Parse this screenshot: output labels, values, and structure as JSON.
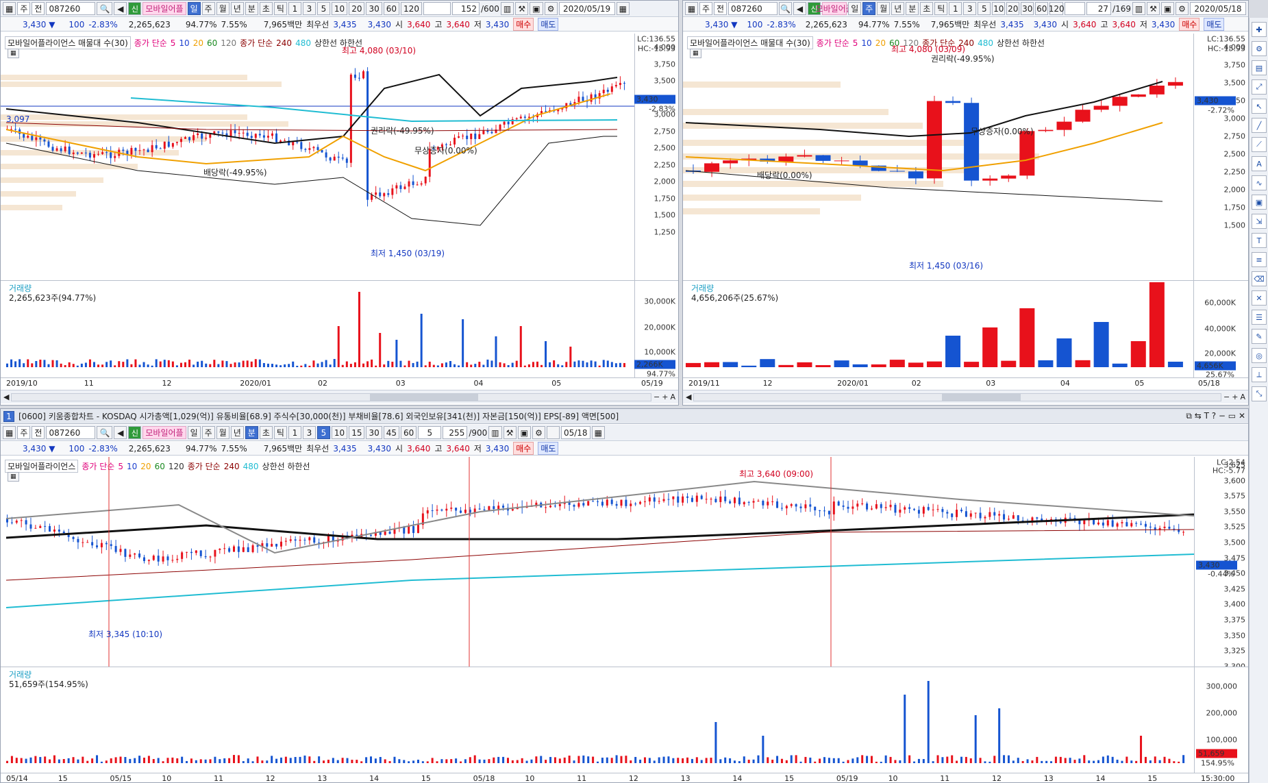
{
  "common": {
    "market": "주",
    "prev": "전",
    "code": "087260",
    "name": "모바일어플",
    "badge": "신",
    "price": "3,430",
    "arrow": "▼",
    "change": "100",
    "change_pct": "-2.83%",
    "volume": "2,265,623",
    "vol_ratio": "94.77%",
    "turnover": "7.55%",
    "amount": "7,965백만",
    "bid_label": "최우선",
    "bid1": "3,435",
    "bid2": "3,430",
    "open_label": "시",
    "open": "3,640",
    "high_label": "고",
    "high": "3,640",
    "low_label": "저",
    "low": "3,430",
    "buy": "매수",
    "sell": "매도",
    "periods": [
      "일",
      "주",
      "월",
      "년",
      "분",
      "초",
      "틱"
    ],
    "mins": [
      "1",
      "3",
      "5",
      "10",
      "20",
      "30",
      "60",
      "120"
    ]
  },
  "p1": {
    "count": "152",
    "total": "/600",
    "date": "2020/05/19",
    "title": "모바일어플라이언스 매물대 수(30)",
    "ma_label": "종가 단순",
    "ma_vals": [
      "5",
      "10",
      "20",
      "60",
      "120"
    ],
    "ma2_label": "종가 단순",
    "ma2_vals": [
      "240",
      "480"
    ],
    "limits": "상한선 하한선",
    "lc": "LC:136.55",
    "hc": "HC:-15.93",
    "price_ticks": [
      "4,000",
      "3,750",
      "3,500",
      "3,250",
      "3,000",
      "2,750",
      "2,500",
      "2,250",
      "2,000",
      "1,750",
      "1,500",
      "1,250"
    ],
    "cur_tag": "3,430",
    "cur_pct": "-2.83%",
    "hline": "3,097",
    "max_ann": "최고 4,080 (03/10)",
    "min_ann": "최저 1,450 (03/19)",
    "ann1": "권리락(-49.95%)",
    "ann2": "무상증자(0.00%)",
    "ann3": "배당락(-49.95%)",
    "vol_title": "거래량",
    "vol_val": "2,265,623주(94.77%)",
    "vol_ticks": [
      "30,000K",
      "20,000K",
      "10,000K"
    ],
    "vol_tag": "2,266K",
    "vol_pct": "94.77%",
    "xlabels": [
      "2019/10",
      "11",
      "12",
      "2020/01",
      "02",
      "03",
      "04",
      "05"
    ],
    "xend": "05/19"
  },
  "p2": {
    "count": "27",
    "total": "/169",
    "date": "2020/05/18",
    "title": "모바일어플라이언스 매물대 수(30)",
    "ma_label": "종가 단순",
    "ma_vals": [
      "5",
      "10",
      "20",
      "60",
      "120"
    ],
    "ma2_label": "종가 단순",
    "ma2_vals": [
      "240",
      "480"
    ],
    "limits": "상한선 하한선",
    "lc": "LC:136.55",
    "hc": "HC:-15.93",
    "price_ticks": [
      "4,000",
      "3,750",
      "3,500",
      "3,250",
      "3,000",
      "2,750",
      "2,500",
      "2,250",
      "2,000",
      "1,750",
      "1,500"
    ],
    "cur_tag": "3,430",
    "cur_pct": "-2.72%",
    "max_ann": "최고 4,080 (03/09)",
    "min_ann": "최저 1,450 (03/16)",
    "ann1": "권리락(-49.95%)",
    "ann2": "무상증자(0.00%)",
    "ann3": "배당락(0.00%)",
    "vol_title": "거래량",
    "vol_val": "4,656,206주(25.67%)",
    "vol_ticks": [
      "60,000K",
      "40,000K",
      "20,000K"
    ],
    "vol_tag": "4,656K",
    "vol_pct": "25.67%",
    "xlabels": [
      "2019/11",
      "12",
      "2020/01",
      "02",
      "03",
      "04",
      "05"
    ],
    "xend": "05/18"
  },
  "p3": {
    "header": "[0600] 키움종합차트 - KOSDAQ 시가총액[1,029(억)] 유통비율[68.9] 주식수[30,000(천)] 부채비율[78.6] 외국인보유[341(천)] 자본금[150(억)] EPS[-89] 액면[500]",
    "header_num": "1",
    "mins": [
      "1",
      "3",
      "5",
      "10",
      "15",
      "30",
      "45",
      "60"
    ],
    "interval": "5",
    "count": "255",
    "total": "/900",
    "date": "05/18",
    "title": "모바일어플라이언스",
    "ma_label": "종가 단순",
    "ma_vals": [
      "5",
      "10",
      "20",
      "60",
      "120"
    ],
    "ma2_label": "종가 단순",
    "ma2_vals": [
      "240",
      "480"
    ],
    "limits": "상한선 하한선",
    "lc": "LC:2.54",
    "hc": "HC:-5.77",
    "price_ticks": [
      "3,625",
      "3,600",
      "3,575",
      "3,550",
      "3,525",
      "3,500",
      "3,475",
      "3,450",
      "3,425",
      "3,400",
      "3,375",
      "3,350",
      "3,325",
      "3,300"
    ],
    "cur_tag": "3,430",
    "cur_pct": "-0.44%",
    "max_ann": "최고 3,640 (09:00)",
    "min_ann": "최저 3,345 (10:10)",
    "vol_title": "거래량",
    "vol_val": "51,659주(154.95%)",
    "vol_ticks": [
      "300,000",
      "200,000",
      "100,000"
    ],
    "vol_tag": "51,659",
    "vol_pct": "154.95%",
    "xlabels": [
      "05/14",
      "15",
      "05/15",
      "10",
      "11",
      "12",
      "13",
      "14",
      "15",
      "05/18",
      "10",
      "11",
      "12",
      "13",
      "14",
      "15",
      "05/19",
      "10",
      "11",
      "12",
      "13",
      "14",
      "15"
    ],
    "xend": "15:30:00"
  },
  "colors": {
    "up": "#e8111b",
    "down": "#1554d1",
    "ma5": "#e0007a",
    "ma10": "#1c3fcf",
    "ma20": "#f0a000",
    "ma60": "#1a8a20",
    "bb": "#111111",
    "ma120": "#777777",
    "ma240": "#8b0000",
    "ma480": "#1fbcd2"
  }
}
